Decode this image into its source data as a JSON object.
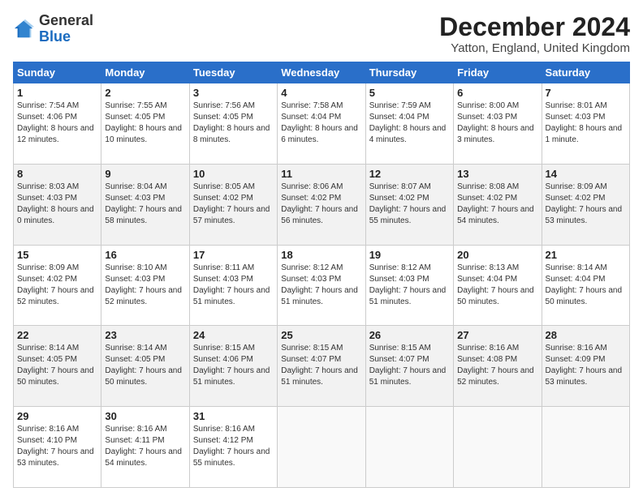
{
  "logo": {
    "general": "General",
    "blue": "Blue"
  },
  "header": {
    "month": "December 2024",
    "location": "Yatton, England, United Kingdom"
  },
  "days_of_week": [
    "Sunday",
    "Monday",
    "Tuesday",
    "Wednesday",
    "Thursday",
    "Friday",
    "Saturday"
  ],
  "weeks": [
    [
      {
        "day": "1",
        "sunrise": "7:54 AM",
        "sunset": "4:06 PM",
        "daylight": "8 hours and 12 minutes."
      },
      {
        "day": "2",
        "sunrise": "7:55 AM",
        "sunset": "4:05 PM",
        "daylight": "8 hours and 10 minutes."
      },
      {
        "day": "3",
        "sunrise": "7:56 AM",
        "sunset": "4:05 PM",
        "daylight": "8 hours and 8 minutes."
      },
      {
        "day": "4",
        "sunrise": "7:58 AM",
        "sunset": "4:04 PM",
        "daylight": "8 hours and 6 minutes."
      },
      {
        "day": "5",
        "sunrise": "7:59 AM",
        "sunset": "4:04 PM",
        "daylight": "8 hours and 4 minutes."
      },
      {
        "day": "6",
        "sunrise": "8:00 AM",
        "sunset": "4:03 PM",
        "daylight": "8 hours and 3 minutes."
      },
      {
        "day": "7",
        "sunrise": "8:01 AM",
        "sunset": "4:03 PM",
        "daylight": "8 hours and 1 minute."
      }
    ],
    [
      {
        "day": "8",
        "sunrise": "8:03 AM",
        "sunset": "4:03 PM",
        "daylight": "8 hours and 0 minutes."
      },
      {
        "day": "9",
        "sunrise": "8:04 AM",
        "sunset": "4:03 PM",
        "daylight": "7 hours and 58 minutes."
      },
      {
        "day": "10",
        "sunrise": "8:05 AM",
        "sunset": "4:02 PM",
        "daylight": "7 hours and 57 minutes."
      },
      {
        "day": "11",
        "sunrise": "8:06 AM",
        "sunset": "4:02 PM",
        "daylight": "7 hours and 56 minutes."
      },
      {
        "day": "12",
        "sunrise": "8:07 AM",
        "sunset": "4:02 PM",
        "daylight": "7 hours and 55 minutes."
      },
      {
        "day": "13",
        "sunrise": "8:08 AM",
        "sunset": "4:02 PM",
        "daylight": "7 hours and 54 minutes."
      },
      {
        "day": "14",
        "sunrise": "8:09 AM",
        "sunset": "4:02 PM",
        "daylight": "7 hours and 53 minutes."
      }
    ],
    [
      {
        "day": "15",
        "sunrise": "8:09 AM",
        "sunset": "4:02 PM",
        "daylight": "7 hours and 52 minutes."
      },
      {
        "day": "16",
        "sunrise": "8:10 AM",
        "sunset": "4:03 PM",
        "daylight": "7 hours and 52 minutes."
      },
      {
        "day": "17",
        "sunrise": "8:11 AM",
        "sunset": "4:03 PM",
        "daylight": "7 hours and 51 minutes."
      },
      {
        "day": "18",
        "sunrise": "8:12 AM",
        "sunset": "4:03 PM",
        "daylight": "7 hours and 51 minutes."
      },
      {
        "day": "19",
        "sunrise": "8:12 AM",
        "sunset": "4:03 PM",
        "daylight": "7 hours and 51 minutes."
      },
      {
        "day": "20",
        "sunrise": "8:13 AM",
        "sunset": "4:04 PM",
        "daylight": "7 hours and 50 minutes."
      },
      {
        "day": "21",
        "sunrise": "8:14 AM",
        "sunset": "4:04 PM",
        "daylight": "7 hours and 50 minutes."
      }
    ],
    [
      {
        "day": "22",
        "sunrise": "8:14 AM",
        "sunset": "4:05 PM",
        "daylight": "7 hours and 50 minutes."
      },
      {
        "day": "23",
        "sunrise": "8:14 AM",
        "sunset": "4:05 PM",
        "daylight": "7 hours and 50 minutes."
      },
      {
        "day": "24",
        "sunrise": "8:15 AM",
        "sunset": "4:06 PM",
        "daylight": "7 hours and 51 minutes."
      },
      {
        "day": "25",
        "sunrise": "8:15 AM",
        "sunset": "4:07 PM",
        "daylight": "7 hours and 51 minutes."
      },
      {
        "day": "26",
        "sunrise": "8:15 AM",
        "sunset": "4:07 PM",
        "daylight": "7 hours and 51 minutes."
      },
      {
        "day": "27",
        "sunrise": "8:16 AM",
        "sunset": "4:08 PM",
        "daylight": "7 hours and 52 minutes."
      },
      {
        "day": "28",
        "sunrise": "8:16 AM",
        "sunset": "4:09 PM",
        "daylight": "7 hours and 53 minutes."
      }
    ],
    [
      {
        "day": "29",
        "sunrise": "8:16 AM",
        "sunset": "4:10 PM",
        "daylight": "7 hours and 53 minutes."
      },
      {
        "day": "30",
        "sunrise": "8:16 AM",
        "sunset": "4:11 PM",
        "daylight": "7 hours and 54 minutes."
      },
      {
        "day": "31",
        "sunrise": "8:16 AM",
        "sunset": "4:12 PM",
        "daylight": "7 hours and 55 minutes."
      },
      null,
      null,
      null,
      null
    ]
  ],
  "labels": {
    "sunrise": "Sunrise:",
    "sunset": "Sunset:",
    "daylight": "Daylight:"
  }
}
